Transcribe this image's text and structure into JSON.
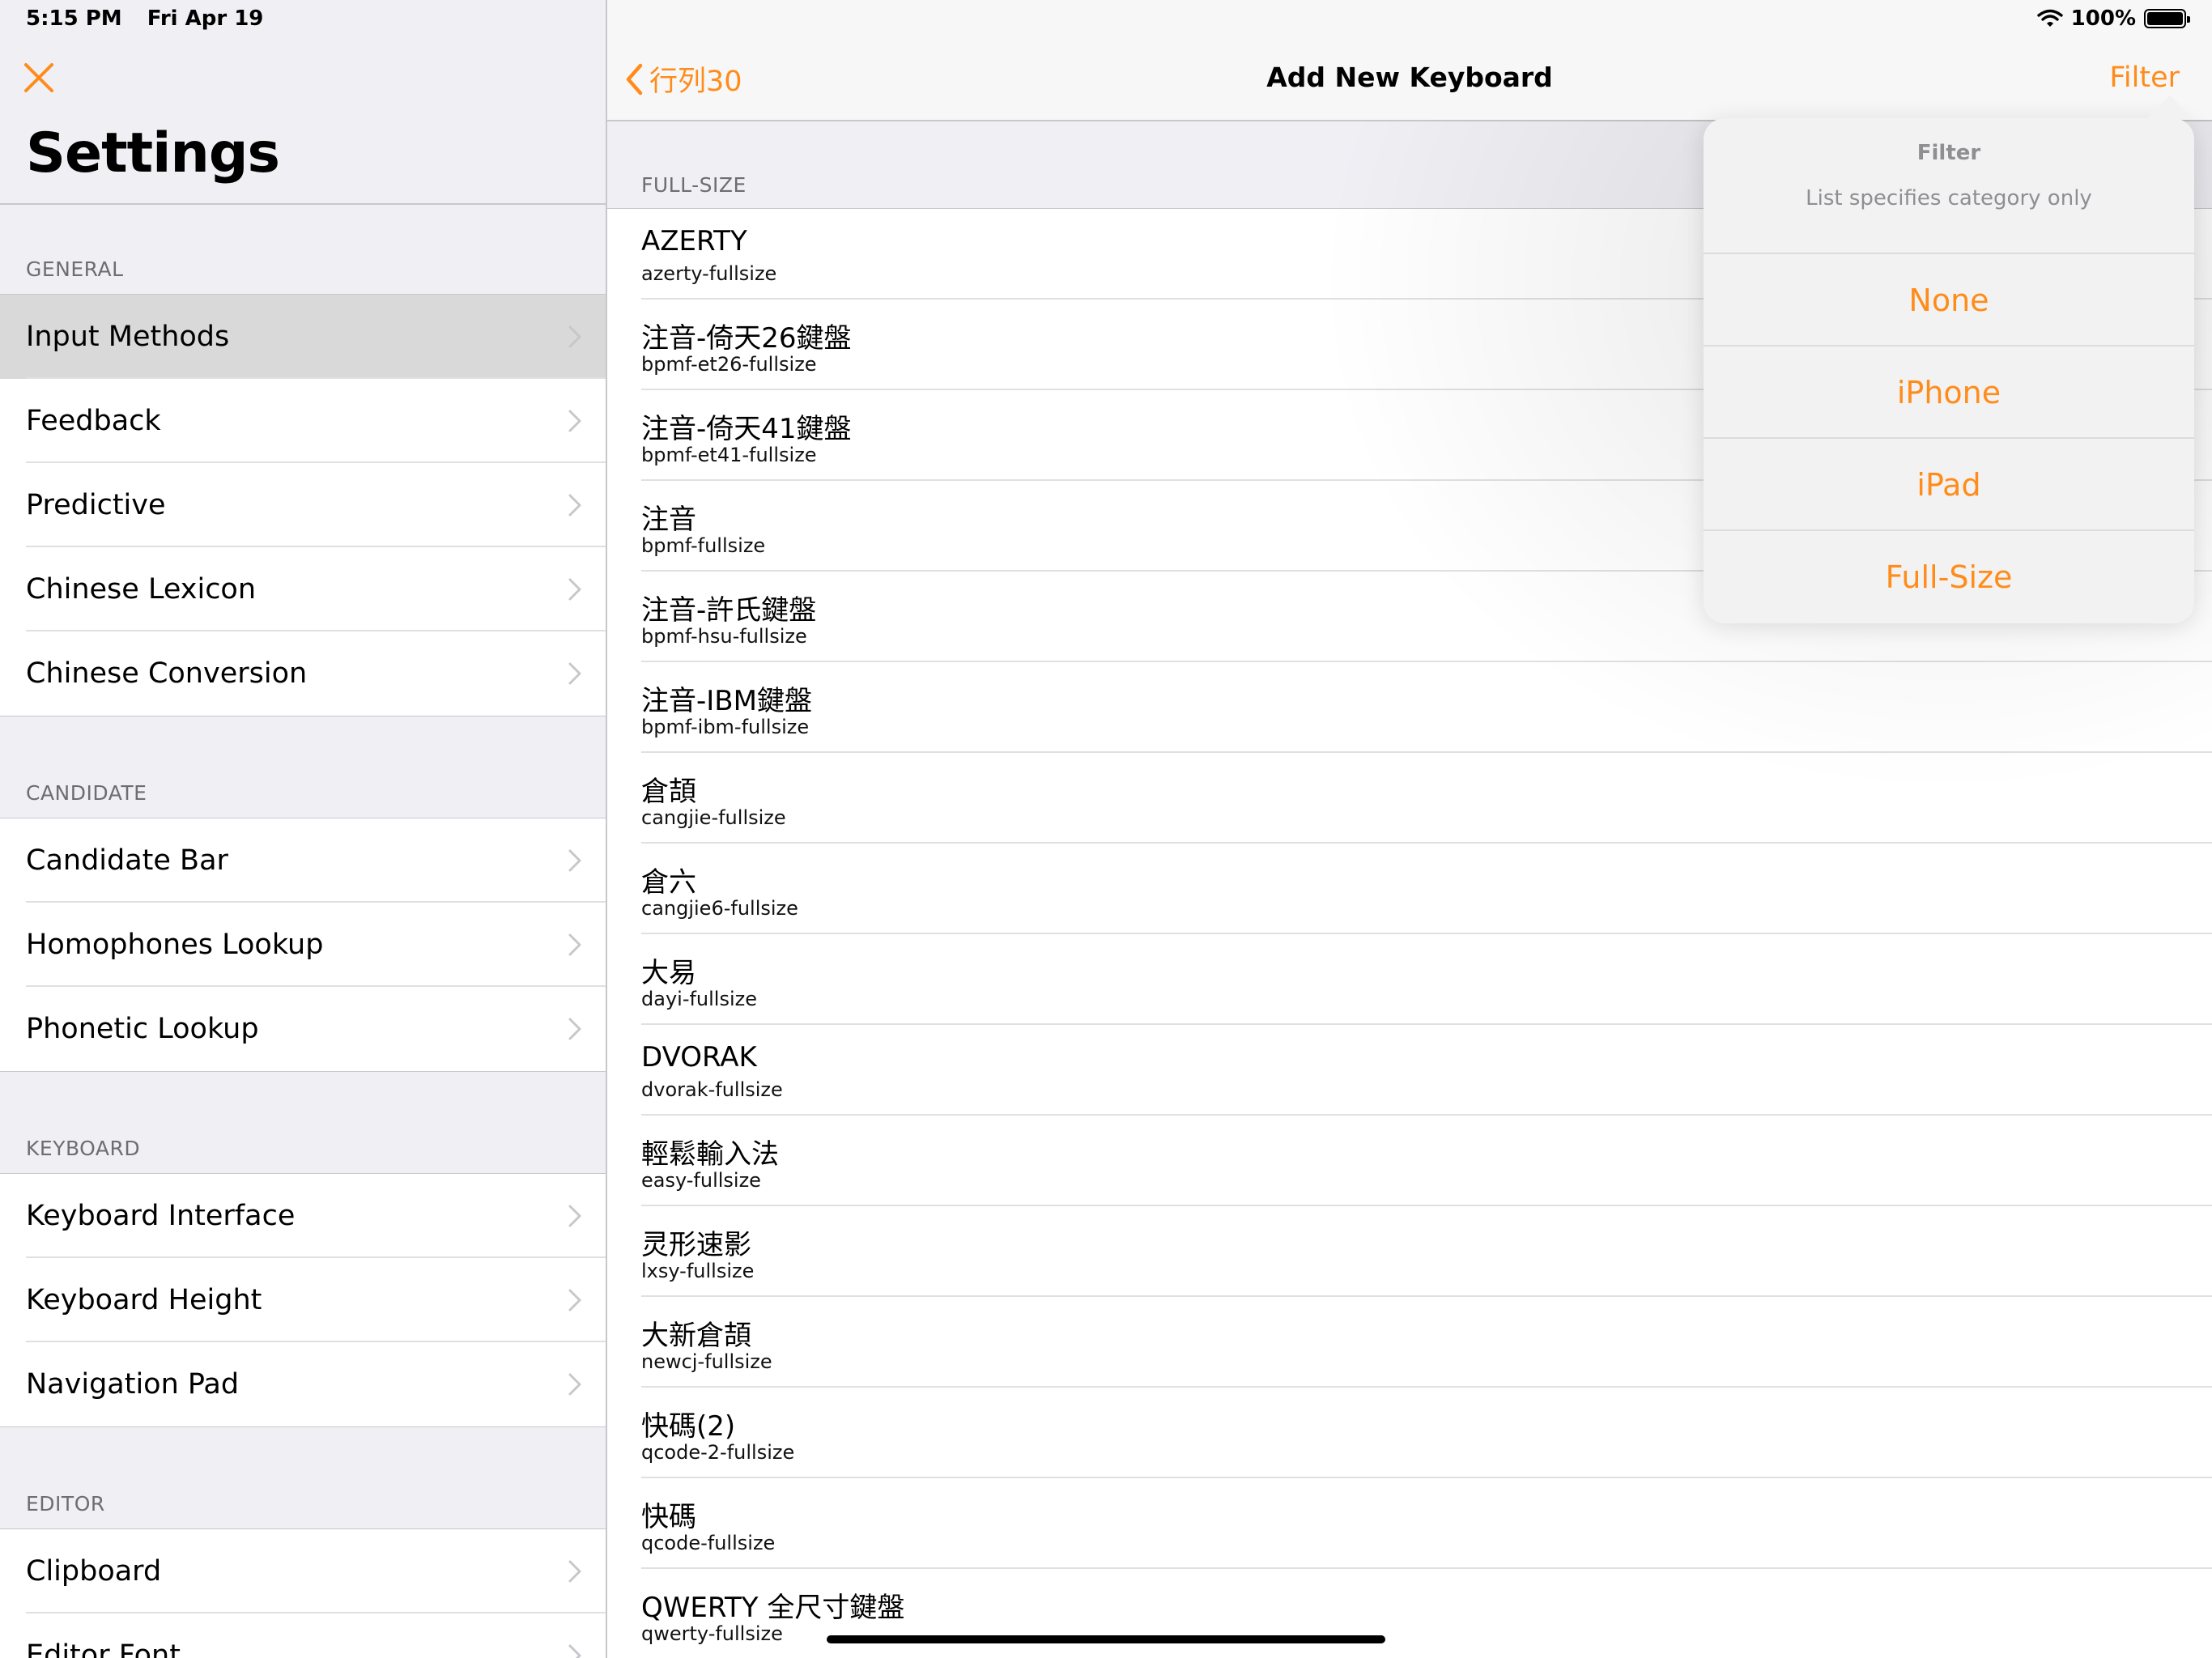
{
  "status_bar": {
    "time": "5:15 PM",
    "date": "Fri Apr 19",
    "battery": "100%"
  },
  "colors": {
    "accent": "#ff8c1a",
    "separator": "#c8c7cc",
    "section_text": "#6d6d72"
  },
  "master": {
    "title": "Settings",
    "sections": [
      {
        "header": "GENERAL",
        "items": [
          "Input Methods",
          "Feedback",
          "Predictive",
          "Chinese Lexicon",
          "Chinese Conversion"
        ],
        "selected_index": 0
      },
      {
        "header": "CANDIDATE",
        "items": [
          "Candidate Bar",
          "Homophones Lookup",
          "Phonetic Lookup"
        ]
      },
      {
        "header": "KEYBOARD",
        "items": [
          "Keyboard Interface",
          "Keyboard Height",
          "Navigation Pad"
        ]
      },
      {
        "header": "EDITOR",
        "items": [
          "Clipboard",
          "Editor Font"
        ]
      }
    ]
  },
  "detail": {
    "back_label": "行列30",
    "title": "Add New Keyboard",
    "filter_label": "Filter",
    "section_header": "FULL-SIZE",
    "keyboards": [
      {
        "name": "AZERTY",
        "id": "azerty-fullsize"
      },
      {
        "name": "注音-倚天26鍵盤",
        "id": "bpmf-et26-fullsize"
      },
      {
        "name": "注音-倚天41鍵盤",
        "id": "bpmf-et41-fullsize"
      },
      {
        "name": "注音",
        "id": "bpmf-fullsize"
      },
      {
        "name": "注音-許氏鍵盤",
        "id": "bpmf-hsu-fullsize"
      },
      {
        "name": "注音-IBM鍵盤",
        "id": "bpmf-ibm-fullsize"
      },
      {
        "name": "倉頡",
        "id": "cangjie-fullsize"
      },
      {
        "name": "倉六",
        "id": "cangjie6-fullsize"
      },
      {
        "name": "大易",
        "id": "dayi-fullsize"
      },
      {
        "name": "DVORAK",
        "id": "dvorak-fullsize"
      },
      {
        "name": "輕鬆輸入法",
        "id": "easy-fullsize"
      },
      {
        "name": "灵形速影",
        "id": "lxsy-fullsize"
      },
      {
        "name": "大新倉頡",
        "id": "newcj-fullsize"
      },
      {
        "name": "快碼(2)",
        "id": "qcode-2-fullsize"
      },
      {
        "name": "快碼",
        "id": "qcode-fullsize"
      },
      {
        "name": "QWERTY 全尺寸鍵盤",
        "id": "qwerty-fullsize"
      }
    ]
  },
  "popover": {
    "title": "Filter",
    "message": "List specifies category only",
    "actions": [
      "None",
      "iPhone",
      "iPad",
      "Full-Size"
    ]
  }
}
